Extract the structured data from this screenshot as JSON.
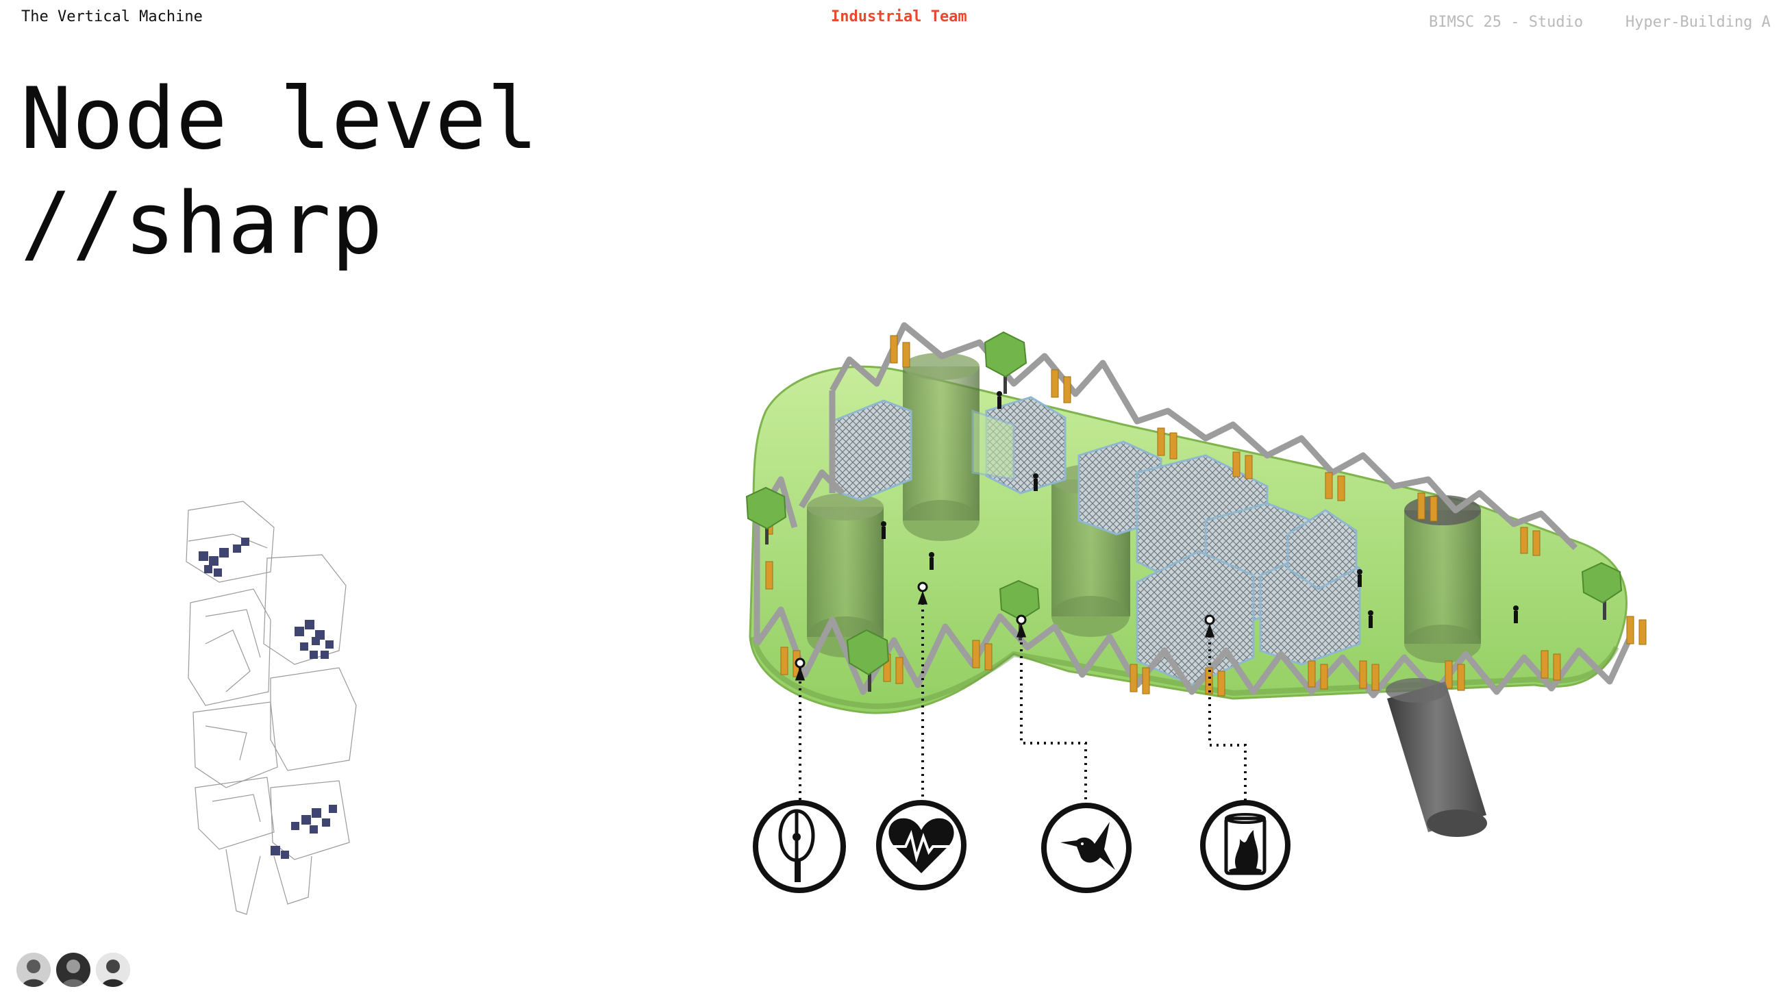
{
  "header": {
    "left": "The Vertical Machine",
    "center": "Industrial Team",
    "right_course": "BIMSC 25 - Studio",
    "right_project": "Hyper-Building A"
  },
  "title": {
    "line1": "Node level",
    "line2": "//sharp"
  },
  "icons": [
    "wind-turbine-icon",
    "heart-pulse-icon",
    "hummingbird-icon",
    "fire-container-icon"
  ],
  "colors": {
    "accent": "#e8482e",
    "platform_green": "#a9dc7a",
    "tree_green": "#6fb24a",
    "turbine_orange": "#d99a2b",
    "core_grey": "#6d6d6d"
  },
  "team": {
    "members": [
      "team-member-1",
      "team-member-2",
      "team-member-3"
    ]
  }
}
